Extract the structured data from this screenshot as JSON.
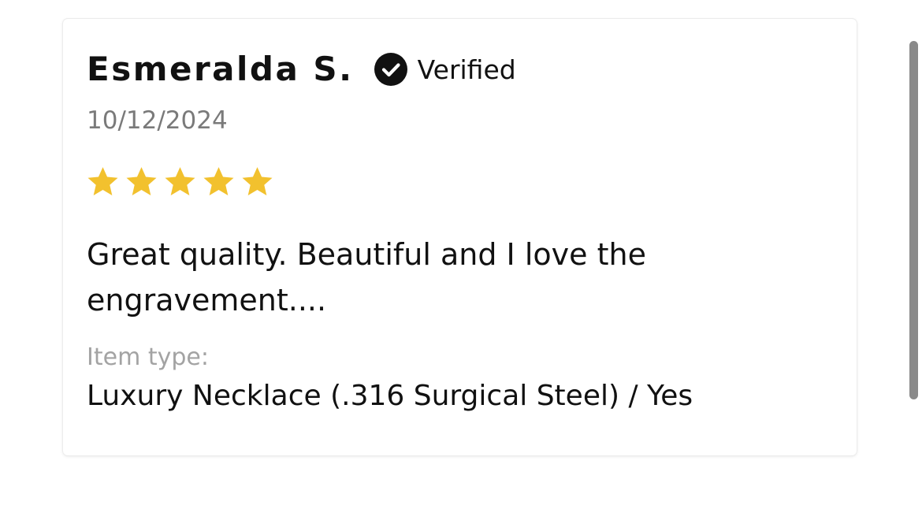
{
  "review": {
    "reviewer_name": "Esmeralda S.",
    "verified_label": "Verified",
    "verified_icon": "check-circle-icon",
    "date": "10/12/2024",
    "rating": 5,
    "rating_max": 5,
    "star_color": "#F2C12E",
    "body": "Great quality. Beautiful and I love the engravement....",
    "item_type_label": "Item type:",
    "item_type_value": "Luxury Necklace (.316 Surgical Steel) / Yes"
  }
}
